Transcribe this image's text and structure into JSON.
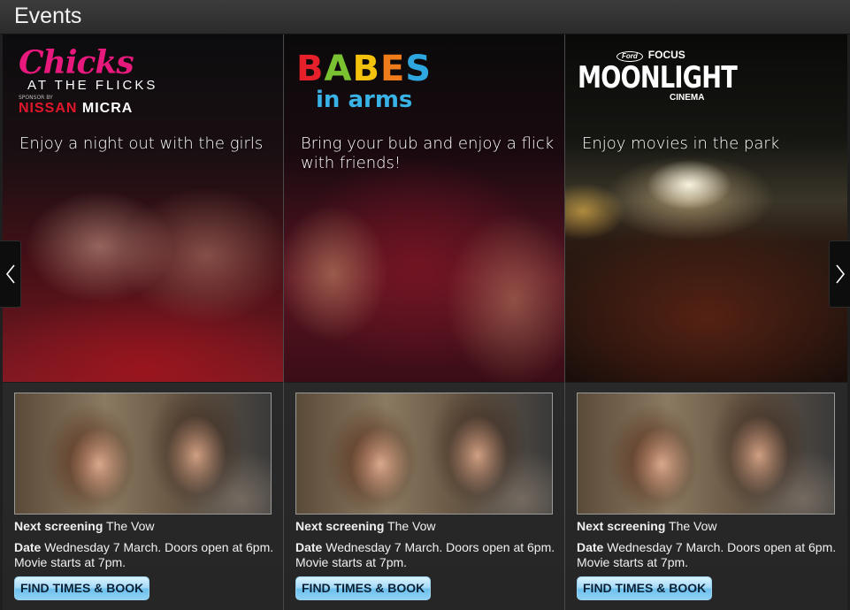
{
  "header": {
    "title": "Events"
  },
  "cards": [
    {
      "logo": {
        "title": "Chicks",
        "subtitle": "AT THE FLICKS",
        "fine_print": "SPONSOR BY",
        "sponsor_brand": "NISSAN",
        "sponsor_model": "MICRA"
      },
      "tagline": "Enjoy a night out with the girls",
      "next_label": "Next screening",
      "movie": "The Vow",
      "date_label": "Date",
      "date_text": "Wednesday 7 March. Doors open at 6pm.",
      "start_text": "Movie starts at 7pm.",
      "button": "FIND TIMES & BOOK"
    },
    {
      "logo": {
        "title_letters": [
          "B",
          "A",
          "B",
          "E",
          "S"
        ],
        "subtitle": "in arms"
      },
      "tagline": "Bring your bub and enjoy a flick with friends!",
      "next_label": "Next screening",
      "movie": "The Vow",
      "date_label": "Date",
      "date_text": "Wednesday 7 March. Doors open at 6pm.",
      "start_text": "Movie starts at 7pm.",
      "button": "FIND TIMES & BOOK"
    },
    {
      "logo": {
        "brand": "Ford",
        "model": "FOCUS",
        "title": "MOONLIGHT",
        "subtitle": "CINEMA"
      },
      "tagline": "Enjoy movies in the park",
      "next_label": "Next screening",
      "movie": "The Vow",
      "date_label": "Date",
      "date_text": "Wednesday 7 March. Doors open at 6pm.",
      "start_text": "Movie starts at 7pm.",
      "button": "FIND TIMES & BOOK"
    }
  ],
  "nav": {
    "prev_icon": "chevron-left-icon",
    "next_icon": "chevron-right-icon"
  },
  "colors": {
    "accent_button": "#a6dbf7",
    "chicks_pink": "#e8197d",
    "nissan_red": "#e2172b",
    "babes_blue": "#39b2e6"
  }
}
